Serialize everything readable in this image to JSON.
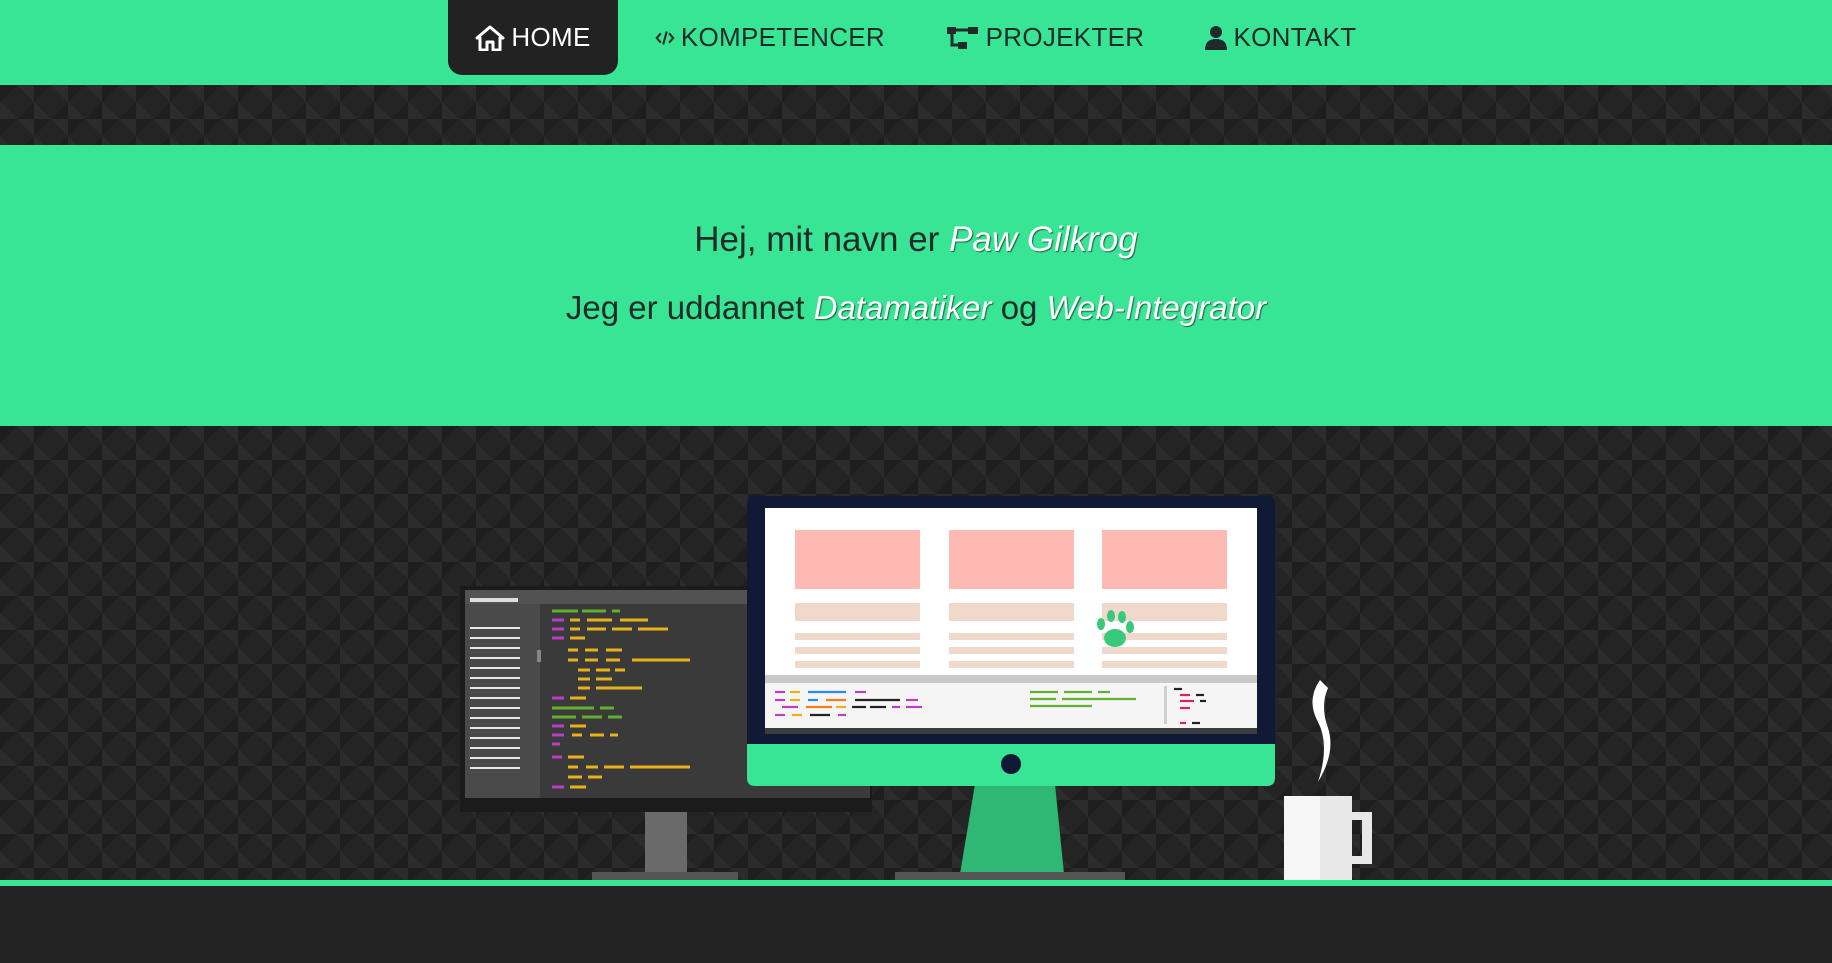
{
  "nav": {
    "items": [
      {
        "label": "HOME",
        "icon": "home-icon",
        "active": true
      },
      {
        "label": "KOMPETENCER",
        "icon": "code-icon",
        "active": false
      },
      {
        "label": "PROJEKTER",
        "icon": "sitemap-icon",
        "active": false
      },
      {
        "label": "KONTAKT",
        "icon": "user-icon",
        "active": false
      }
    ]
  },
  "hero": {
    "greeting_prefix": "Hej, mit navn er",
    "name": "Paw Gilkrog",
    "education_prefix": "Jeg er uddannet",
    "degree1": "Datamatiker",
    "connector": "og",
    "degree2": "Web-Integrator"
  },
  "colors": {
    "accent": "#38e594",
    "dark": "#232323",
    "text": "#222a2a"
  }
}
